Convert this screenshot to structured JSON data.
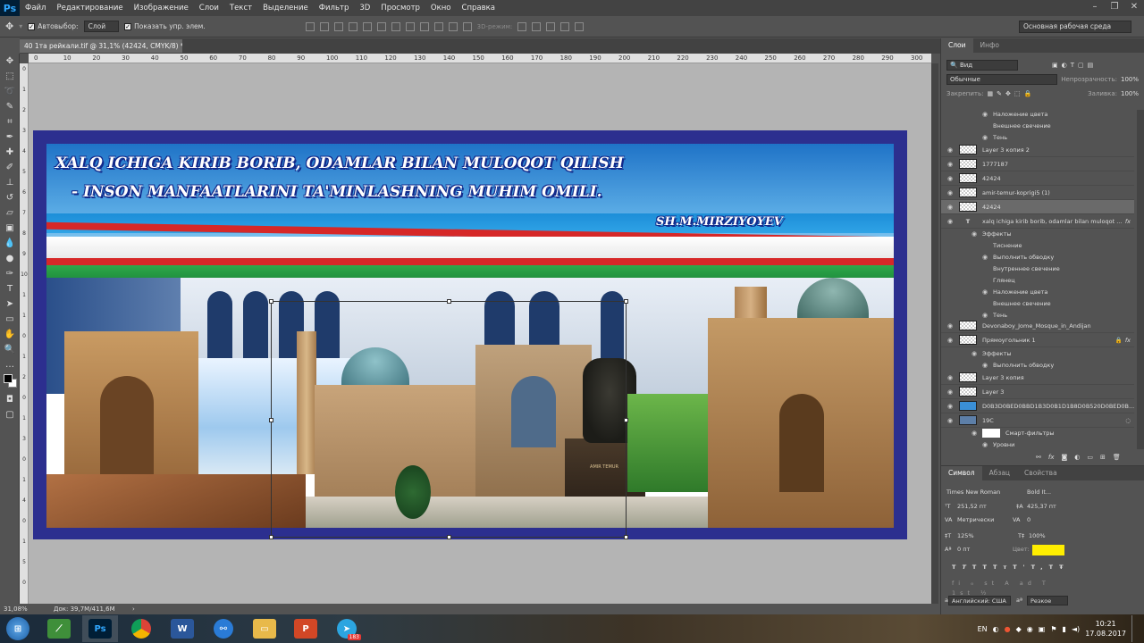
{
  "app": {
    "logo": "Ps"
  },
  "menu": [
    "Файл",
    "Редактирование",
    "Изображение",
    "Слои",
    "Текст",
    "Выделение",
    "Фильтр",
    "3D",
    "Просмотр",
    "Окно",
    "Справка"
  ],
  "options": {
    "autoselect_label": "Автовыбор:",
    "autoselect_value": "Слой",
    "show_controls_label": "Показать упр. элем.",
    "mode_3d": "3D-режим:",
    "workspace": "Основная рабочая среда"
  },
  "document": {
    "tab_title": "40 1та рейкали.tif @ 31,1% (42424, CMYK/8) *",
    "close": "×"
  },
  "ruler_h": [
    "0",
    "10",
    "20",
    "30",
    "40",
    "50",
    "60",
    "70",
    "80",
    "90",
    "100",
    "110",
    "120",
    "130",
    "140",
    "150",
    "160",
    "170",
    "180",
    "190",
    "200",
    "210",
    "220",
    "230",
    "240",
    "250",
    "260",
    "270",
    "280",
    "290",
    "300"
  ],
  "ruler_v": [
    "0",
    "1",
    "2",
    "3",
    "4",
    "5",
    "6",
    "7",
    "8",
    "9",
    "10",
    "1",
    "1",
    "0",
    "1",
    "2",
    "0",
    "1",
    "3",
    "0",
    "1",
    "4",
    "0",
    "1",
    "5",
    "0"
  ],
  "artwork": {
    "line1": "XALQ ICHIGA KIRIB BORIB, ODAMLAR BILAN MULOQOT QILISH",
    "line2": "- INSON MANFAATLARINI  TA'MINLASHNING  MUHIM OMILI.",
    "signature": "SH.M.MIRZIYOYEV",
    "monument_plaque": "AMIR TEMUR"
  },
  "status": {
    "zoom": "31,08%",
    "doc": "Док: 39,7M/411,6M",
    "arrow": "›"
  },
  "panel": {
    "tabs": [
      "Слои",
      "Инфо"
    ],
    "kind_label": "Вид",
    "blend_mode": "Обычные",
    "opacity_label": "Непрозрачность:",
    "opacity": "100%",
    "lock_label": "Закрепить:",
    "fill_label": "Заливка:",
    "fill": "100%",
    "top_effects": [
      "Наложение цвета",
      "Внешнее свечение",
      "Тень"
    ],
    "layers": [
      {
        "name": "Layer 3 копия 2"
      },
      {
        "name": "1777187"
      },
      {
        "name": "42424"
      },
      {
        "name": "amir-temur-koprigi5 (1)"
      },
      {
        "name": "42424"
      },
      {
        "name": "xalq ichiga kirib borib, odamlar bilan muloqot ...",
        "fx": "fx"
      }
    ],
    "text_effects_title": "Эффекты",
    "text_effects": [
      "Тиснение",
      "Выполнить обводку",
      "Внутреннее свечение",
      "Глянец",
      "Наложение цвета",
      "Внешнее свечение",
      "Тень"
    ],
    "layers2": [
      {
        "name": "Devonaboy_Jome_Mosque_in_Andijan"
      },
      {
        "name": "Прямоугольник 1",
        "fx": "fx"
      }
    ],
    "rect_effects_title": "Эффекты",
    "rect_effects": [
      "Выполнить обводку"
    ],
    "layers3": [
      {
        "name": "Layer 3 копия"
      },
      {
        "name": "Layer 3"
      },
      {
        "name": "D0B3D0BED0BBD1B3D0B1D1B8D0B520D0BED0B..."
      },
      {
        "name": "19C"
      }
    ],
    "smart_filters": "Смарт-фильтры",
    "levels": "Уровни"
  },
  "char": {
    "tabs": [
      "Символ",
      "Абзац",
      "Свойства"
    ],
    "font": "Times New Roman",
    "style": "Bold It...",
    "size": "251,52 пт",
    "leading": "425,37 пт",
    "kerning": "Метрически",
    "tracking": "0",
    "vscale": "125%",
    "hscale": "100%",
    "baseline": "0 пт",
    "color_label": "Цвет:",
    "color": "#ffee00",
    "language": "Английский: США",
    "aa": "Резкое",
    "style_buttons": [
      "T",
      "T",
      "TT",
      "Tт",
      "T'",
      "T,",
      "T",
      "T"
    ],
    "ot_buttons": [
      "fi",
      "ℴ",
      "st",
      "A",
      "ad",
      "T",
      "1st",
      "½"
    ]
  },
  "taskbar": {
    "lang": "EN",
    "time": "10:21",
    "date": "17.08.2017",
    "badge": "183"
  },
  "colors": {
    "ps_blue": "#31a8ff",
    "frame": "#2c2f8f",
    "accent_yellow": "#ffee00"
  }
}
